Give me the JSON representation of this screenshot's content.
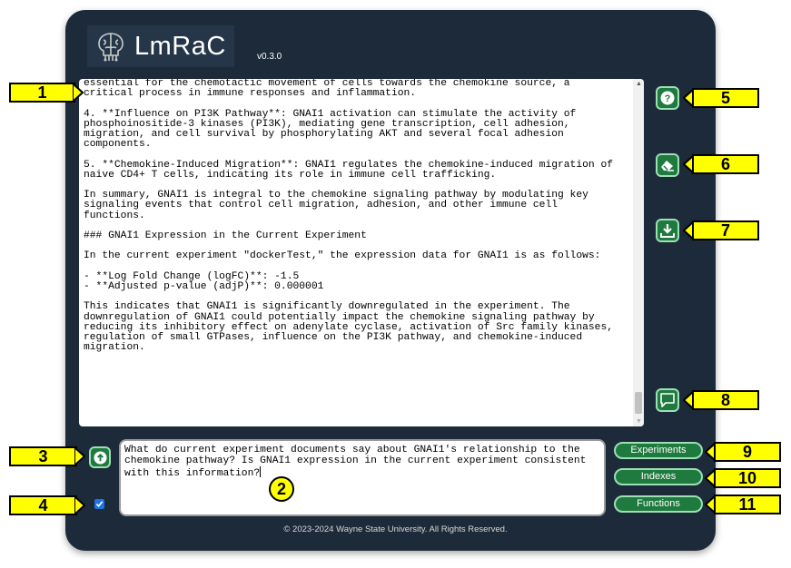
{
  "app": {
    "name": "LmRaC",
    "version": "v0.3.0",
    "logo_icon": "brain-circuit-icon"
  },
  "output": {
    "text": "essential for the chemotactic movement of cells towards the chemokine source, a\ncritical process in immune responses and inflammation.\n\n4. **Influence on PI3K Pathway**: GNAI1 activation can stimulate the activity of\nphosphoinositide-3 kinases (PI3K), mediating gene transcription, cell adhesion,\nmigration, and cell survival by phosphorylating AKT and several focal adhesion\ncomponents.\n\n5. **Chemokine-Induced Migration**: GNAI1 regulates the chemokine-induced migration of\nnaive CD4+ T cells, indicating its role in immune cell trafficking.\n\nIn summary, GNAI1 is integral to the chemokine signaling pathway by modulating key\nsignaling events that control cell migration, adhesion, and other immune cell\nfunctions.\n\n### GNAI1 Expression in the Current Experiment\n\nIn the current experiment \"dockerTest,\" the expression data for GNAI1 is as follows:\n\n- **Log Fold Change (logFC)**: -1.5\n- **Adjusted p-value (adjP)**: 0.000001\n\nThis indicates that GNAI1 is significantly downregulated in the experiment. The\ndownregulation of GNAI1 could potentially impact the chemokine signaling pathway by\nreducing its inhibitory effect on adenylate cyclase, activation of Src family kinases,\nregulation of small GTPases, influence on the PI3K pathway, and chemokine-induced\nmigration."
  },
  "side_buttons": [
    {
      "name": "help-button",
      "icon": "question-circle-icon"
    },
    {
      "name": "clear-button",
      "icon": "eraser-icon"
    },
    {
      "name": "download-button",
      "icon": "download-icon"
    },
    {
      "name": "chat-button",
      "icon": "chat-bubble-icon"
    }
  ],
  "input": {
    "value": "What do current experiment documents say about GNAI1's relationship to the\nchemokine pathway? Is GNAI1 expression in the current experiment consistent\nwith this information?"
  },
  "send_button": {
    "icon": "arrow-up-circle-icon"
  },
  "checkbox": {
    "checked": true
  },
  "menu": {
    "experiments_label": "Experiments",
    "indexes_label": "Indexes",
    "functions_label": "Functions"
  },
  "footer": {
    "text": "© 2023-2024 Wayne State University. All Rights Reserved."
  },
  "callouts": [
    "1",
    "2",
    "3",
    "4",
    "5",
    "6",
    "7",
    "8",
    "9",
    "10",
    "11"
  ],
  "colors": {
    "panel": "#1d2a3a",
    "button_green": "#1f7a3f",
    "button_border": "#9ce0b4",
    "callout_yellow": "#ffff00"
  }
}
